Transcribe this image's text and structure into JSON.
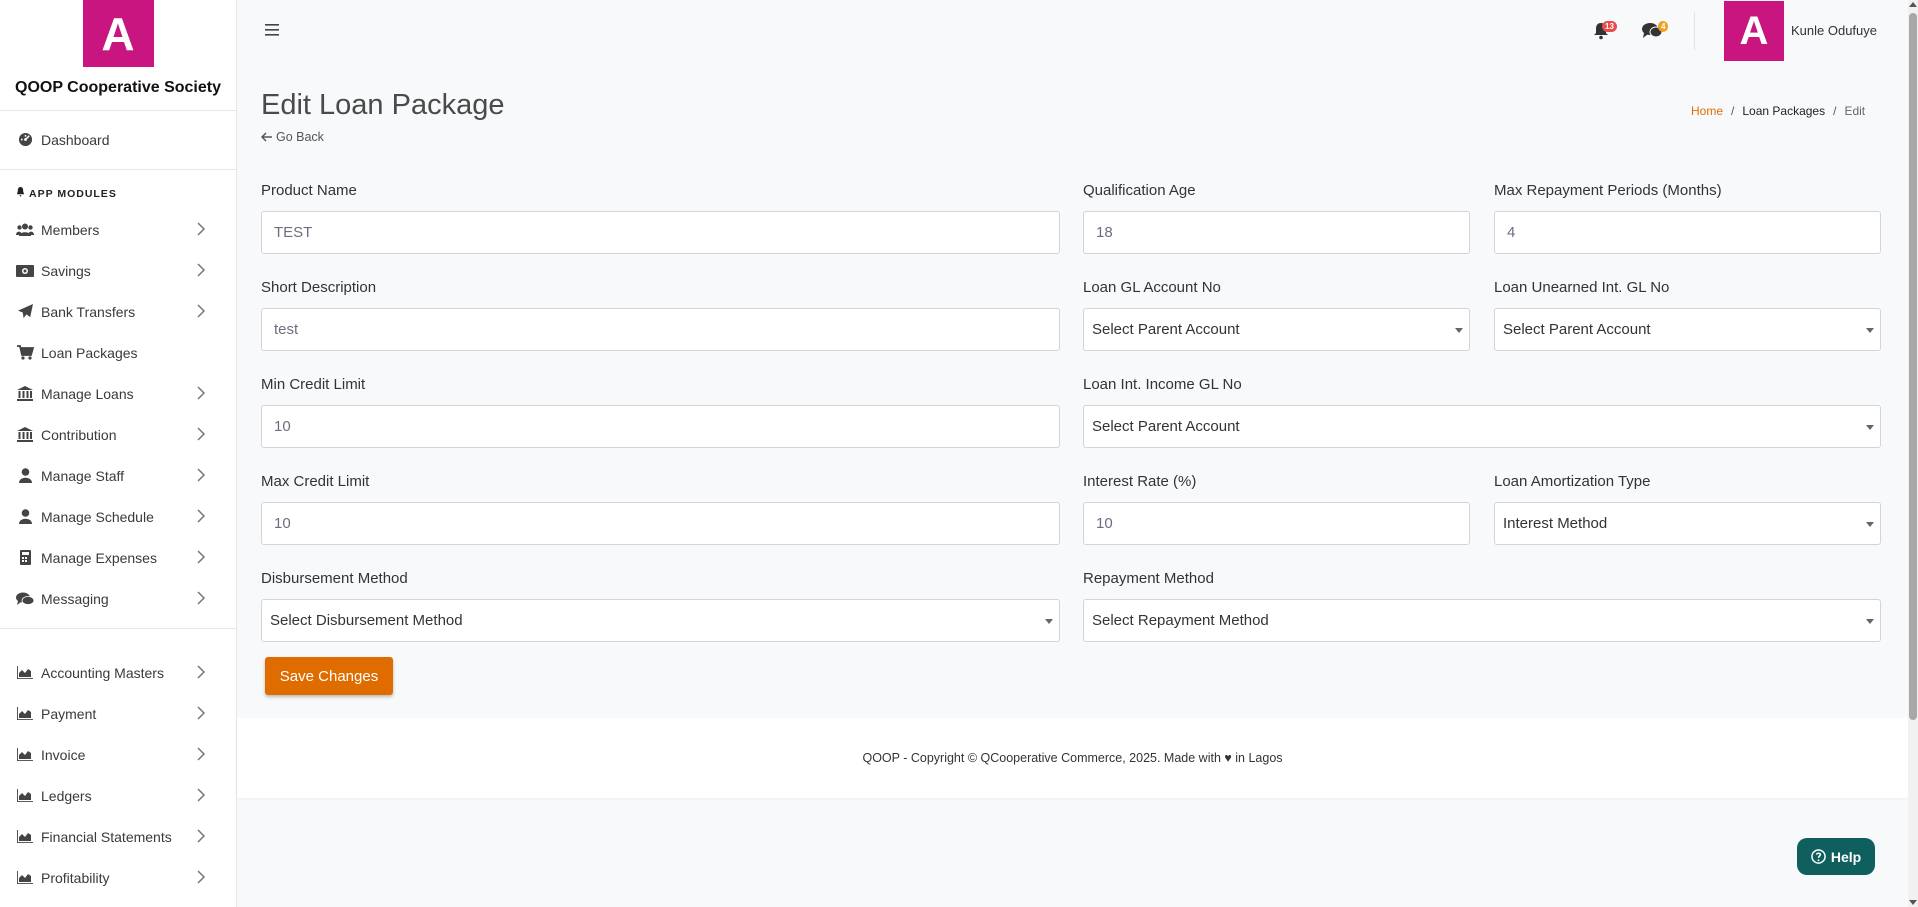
{
  "brand": {
    "logo_letter": "A",
    "name": "QOOP Cooperative Society",
    "color": "#c8157f"
  },
  "sidebar": {
    "dashboard": "Dashboard",
    "section_title": "APP MODULES",
    "items": [
      {
        "label": "Members",
        "icon": "users-icon"
      },
      {
        "label": "Savings",
        "icon": "money-icon"
      },
      {
        "label": "Bank Transfers",
        "icon": "paper-plane-icon"
      },
      {
        "label": "Loan Packages",
        "icon": "cart-icon"
      },
      {
        "label": "Manage Loans",
        "icon": "bank-icon"
      },
      {
        "label": "Contribution",
        "icon": "bank-icon"
      },
      {
        "label": "Manage Staff",
        "icon": "user-icon"
      },
      {
        "label": "Manage Schedule",
        "icon": "user-icon"
      },
      {
        "label": "Manage Expenses",
        "icon": "calculator-icon"
      },
      {
        "label": "Messaging",
        "icon": "comments-icon"
      }
    ],
    "items2": [
      {
        "label": "Accounting Masters",
        "icon": "chart-area-icon"
      },
      {
        "label": "Payment",
        "icon": "chart-area-icon"
      },
      {
        "label": "Invoice",
        "icon": "chart-area-icon"
      },
      {
        "label": "Ledgers",
        "icon": "chart-area-icon"
      },
      {
        "label": "Financial Statements",
        "icon": "chart-area-icon"
      },
      {
        "label": "Profitability",
        "icon": "chart-area-icon"
      }
    ]
  },
  "topbar": {
    "notifications_count": "13",
    "messages_count": "4",
    "avatar_letter": "A",
    "username": "Kunle Odufuye"
  },
  "header": {
    "title": "Edit Loan Package",
    "go_back": "Go Back",
    "breadcrumb": {
      "home": "Home",
      "section": "Loan Packages",
      "current": "Edit",
      "sep": "/"
    }
  },
  "form": {
    "product_name": {
      "label": "Product Name",
      "value": "TEST"
    },
    "qualification_age": {
      "label": "Qualification Age",
      "value": "18"
    },
    "max_repayment": {
      "label": "Max Repayment Periods (Months)",
      "value": "4"
    },
    "short_description": {
      "label": "Short Description",
      "value": "test"
    },
    "loan_gl_account": {
      "label": "Loan GL Account No",
      "value": "Select Parent Account"
    },
    "loan_unearned": {
      "label": "Loan Unearned Int. GL No",
      "value": "Select Parent Account"
    },
    "min_credit": {
      "label": "Min Credit Limit",
      "value": "10"
    },
    "loan_int_income": {
      "label": "Loan Int. Income GL No",
      "value": "Select Parent Account"
    },
    "max_credit": {
      "label": "Max Credit Limit",
      "value": "10"
    },
    "interest_rate": {
      "label": "Interest Rate (%)",
      "value": "10"
    },
    "amortization": {
      "label": "Loan Amortization Type",
      "value": "Interest Method"
    },
    "disbursement": {
      "label": "Disbursement Method",
      "value": "Select Disbursement Method"
    },
    "repayment": {
      "label": "Repayment Method",
      "value": "Select Repayment Method"
    },
    "save_label": "Save Changes"
  },
  "footer": {
    "text": "QOOP - Copyright © QCooperative Commerce, 2025. Made with ♥ in Lagos"
  },
  "help": {
    "label": "Help"
  },
  "colors": {
    "accent": "#e06c00",
    "brand": "#c8157f",
    "help": "#0e5f5e"
  }
}
